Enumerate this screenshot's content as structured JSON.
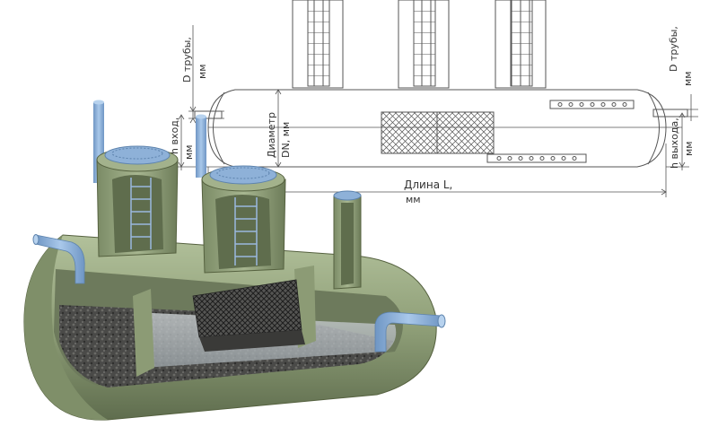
{
  "drawing": {
    "d_pipe_left": "D трубы,",
    "d_pipe_left_unit": "мм",
    "h_inlet": "h вход,",
    "h_inlet_unit": "мм",
    "diameter": "Диаметр",
    "diameter_unit": "DN, мм",
    "length": "Длина L,",
    "length_unit": "мм",
    "d_pipe_right": "D трубы,",
    "d_pipe_right_unit": "мм",
    "h_outlet": "h выхода,",
    "h_outlet_unit": "мм"
  },
  "colors": {
    "tank_green": "#9aaa84",
    "tank_green_dark": "#6f7f5e",
    "pipe_blue": "#8fb4dd",
    "lines": "#555555"
  }
}
